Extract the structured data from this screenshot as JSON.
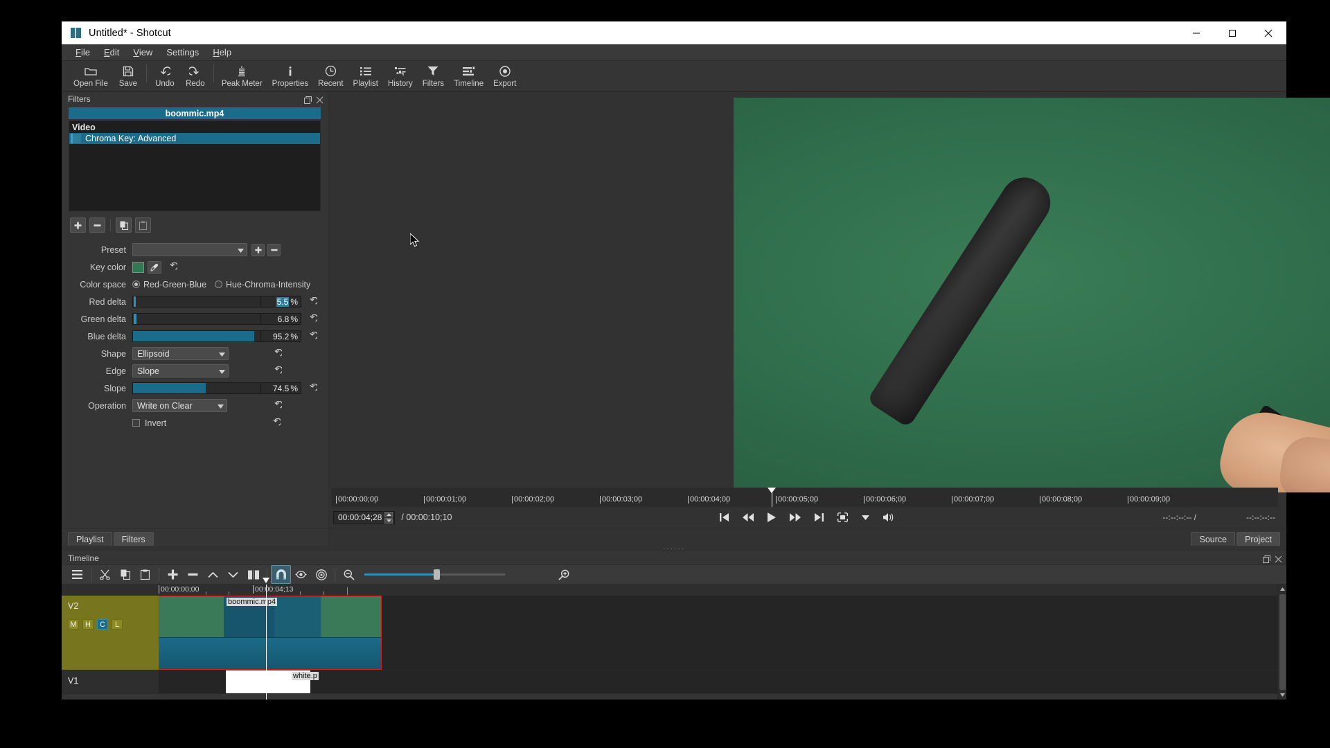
{
  "window": {
    "title": "Untitled* - Shotcut",
    "controls": {
      "minimize": "minimize-button",
      "maximize": "maximize-button",
      "close": "close-button"
    }
  },
  "menubar": {
    "items": [
      {
        "label": "File",
        "mnemonic": "F"
      },
      {
        "label": "Edit",
        "mnemonic": "E"
      },
      {
        "label": "View",
        "mnemonic": "V"
      },
      {
        "label": "Settings",
        "mnemonic": "S"
      },
      {
        "label": "Help",
        "mnemonic": "H"
      }
    ]
  },
  "toolbar": {
    "buttons": [
      {
        "label": "Open File",
        "icon": "folder-icon"
      },
      {
        "label": "Save",
        "icon": "save-icon"
      },
      {
        "label": "Undo",
        "icon": "undo-icon"
      },
      {
        "label": "Redo",
        "icon": "redo-icon"
      },
      {
        "label": "Peak Meter",
        "icon": "peak-meter-icon"
      },
      {
        "label": "Properties",
        "icon": "info-icon"
      },
      {
        "label": "Recent",
        "icon": "clock-icon"
      },
      {
        "label": "Playlist",
        "icon": "list-icon"
      },
      {
        "label": "History",
        "icon": "history-icon"
      },
      {
        "label": "Filters",
        "icon": "funnel-icon"
      },
      {
        "label": "Timeline",
        "icon": "timeline-icon"
      },
      {
        "label": "Export",
        "icon": "export-icon"
      }
    ]
  },
  "filters_panel": {
    "title": "Filters",
    "source_name": "boommic.mp4",
    "group_label": "Video",
    "applied": [
      {
        "name": "Chroma Key: Advanced",
        "enabled": true,
        "selected": true
      }
    ],
    "actions": [
      {
        "name": "add-filter",
        "glyph": "+"
      },
      {
        "name": "remove-filter",
        "glyph": "−"
      },
      {
        "name": "copy-filters",
        "glyph": "copy"
      },
      {
        "name": "paste-filters",
        "glyph": "paste"
      }
    ],
    "parameters": {
      "preset": {
        "label": "Preset",
        "value": "",
        "add_label": "+",
        "remove_label": "−"
      },
      "key_color": {
        "label": "Key color",
        "value": "#2f7a52"
      },
      "color_space": {
        "label": "Color space",
        "options": [
          "Red-Green-Blue",
          "Hue-Chroma-Intensity"
        ],
        "selected": "Red-Green-Blue"
      },
      "red_delta": {
        "label": "Red delta",
        "value": "5.5",
        "unit": "%",
        "percent": 5.5,
        "selected": true
      },
      "green_delta": {
        "label": "Green delta",
        "value": "6.8",
        "unit": "%",
        "percent": 6.8
      },
      "blue_delta": {
        "label": "Blue delta",
        "value": "95.2",
        "unit": "%",
        "percent": 95.2
      },
      "shape": {
        "label": "Shape",
        "value": "Ellipsoid"
      },
      "edge": {
        "label": "Edge",
        "value": "Slope"
      },
      "slope": {
        "label": "Slope",
        "value": "74.5",
        "unit": "%",
        "percent": 74.5
      },
      "operation": {
        "label": "Operation",
        "value": "Write on Clear"
      },
      "invert": {
        "label": "Invert",
        "checked": false
      }
    },
    "tabs": [
      {
        "label": "Playlist",
        "active": false
      },
      {
        "label": "Filters",
        "active": true
      }
    ]
  },
  "player": {
    "tabs": [
      {
        "label": "Source",
        "active": false
      },
      {
        "label": "Project",
        "active": true
      }
    ],
    "ruler_labels": [
      "00:00:00;00",
      "00:00:01;00",
      "00:00:02;00",
      "00:00:03;00",
      "00:00:04;00",
      "00:00:05;00",
      "00:00:06;00",
      "00:00:07;00",
      "00:00:08;00",
      "00:00:09;00"
    ],
    "current_time": "00:00:04;28",
    "total_time": "00:00:10;10",
    "time_separator": "/",
    "in_point": "--:--:--:--",
    "out_point": "--:--:--:--",
    "selected_duration_separator": "/",
    "transport": [
      {
        "name": "skip-to-start-button",
        "icon": "skip-start-icon"
      },
      {
        "name": "rewind-button",
        "icon": "rewind-icon"
      },
      {
        "name": "play-button",
        "icon": "play-icon"
      },
      {
        "name": "fast-forward-button",
        "icon": "fast-forward-icon"
      },
      {
        "name": "skip-to-end-button",
        "icon": "skip-end-icon"
      },
      {
        "name": "grab-frame-button",
        "icon": "grab-frame-icon"
      },
      {
        "name": "player-options-button",
        "icon": "chevron-down-icon"
      },
      {
        "name": "volume-button",
        "icon": "volume-icon"
      }
    ]
  },
  "timeline": {
    "title": "Timeline",
    "toolbar": [
      {
        "name": "timeline-menu-button",
        "icon": "hamburger-icon"
      },
      {
        "name": "cut-button",
        "icon": "scissors-icon"
      },
      {
        "name": "copy-button",
        "icon": "copy-icon"
      },
      {
        "name": "paste-button",
        "icon": "paste-icon"
      },
      {
        "name": "append-button",
        "icon": "plus-icon"
      },
      {
        "name": "ripple-delete-button",
        "icon": "minus-icon"
      },
      {
        "name": "lift-button",
        "icon": "chevron-up-icon"
      },
      {
        "name": "overwrite-button",
        "icon": "chevron-down-icon"
      },
      {
        "name": "split-button",
        "icon": "split-icon"
      },
      {
        "name": "snap-button",
        "icon": "magnet-icon",
        "active": true
      },
      {
        "name": "scrub-while-dragging-button",
        "icon": "eye-icon"
      },
      {
        "name": "ripple-all-tracks-button",
        "icon": "target-icon"
      },
      {
        "name": "zoom-out-button",
        "icon": "zoom-out-icon"
      },
      {
        "name": "zoom-in-button",
        "icon": "zoom-in-icon"
      }
    ],
    "ruler_labels": [
      "00:00:00;00",
      "00:00:04;13"
    ],
    "tracks": [
      {
        "name": "V2",
        "badges": [
          {
            "label": "M",
            "active": false
          },
          {
            "label": "H",
            "active": false
          },
          {
            "label": "C",
            "active": true
          },
          {
            "label": "L",
            "active": false
          }
        ],
        "clips": [
          {
            "label": "boommic.mp4",
            "selected": true
          }
        ]
      },
      {
        "name": "V1",
        "badges": [],
        "clips": [
          {
            "label": "white.p",
            "selected": false
          }
        ]
      }
    ]
  },
  "colors": {
    "accent": "#1b6b8a",
    "accent_bright": "#2f8fb3",
    "track_head": "#77761f",
    "selection_border": "#cc2222",
    "key_color": "#2f7a52",
    "panel_bg": "#353535",
    "list_bg": "#1e1e1e"
  }
}
